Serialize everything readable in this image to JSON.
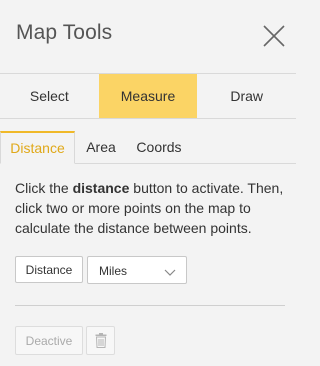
{
  "header": {
    "title": "Map Tools",
    "close_icon": "close-icon"
  },
  "main_tabs": [
    {
      "label": "Select",
      "active": false
    },
    {
      "label": "Measure",
      "active": true
    },
    {
      "label": "Draw",
      "active": false
    }
  ],
  "sub_tabs": [
    {
      "label": "Distance",
      "active": true
    },
    {
      "label": "Area",
      "active": false
    },
    {
      "label": "Coords",
      "active": false
    }
  ],
  "instructions": {
    "prefix": "Click the ",
    "keyword": "distance",
    "suffix": " button to activate. Then, click two or more points on the map to calculate the distance between points."
  },
  "controls": {
    "distance_button_label": "Distance",
    "units_select_value": "Miles",
    "units_options": [
      "Miles"
    ]
  },
  "footer": {
    "deactive_label": "Deactive",
    "delete_icon": "trash-icon"
  },
  "colors": {
    "accent": "#fbd465",
    "active_subtab_text": "#e0a91a",
    "background": "#f3f3f3"
  }
}
